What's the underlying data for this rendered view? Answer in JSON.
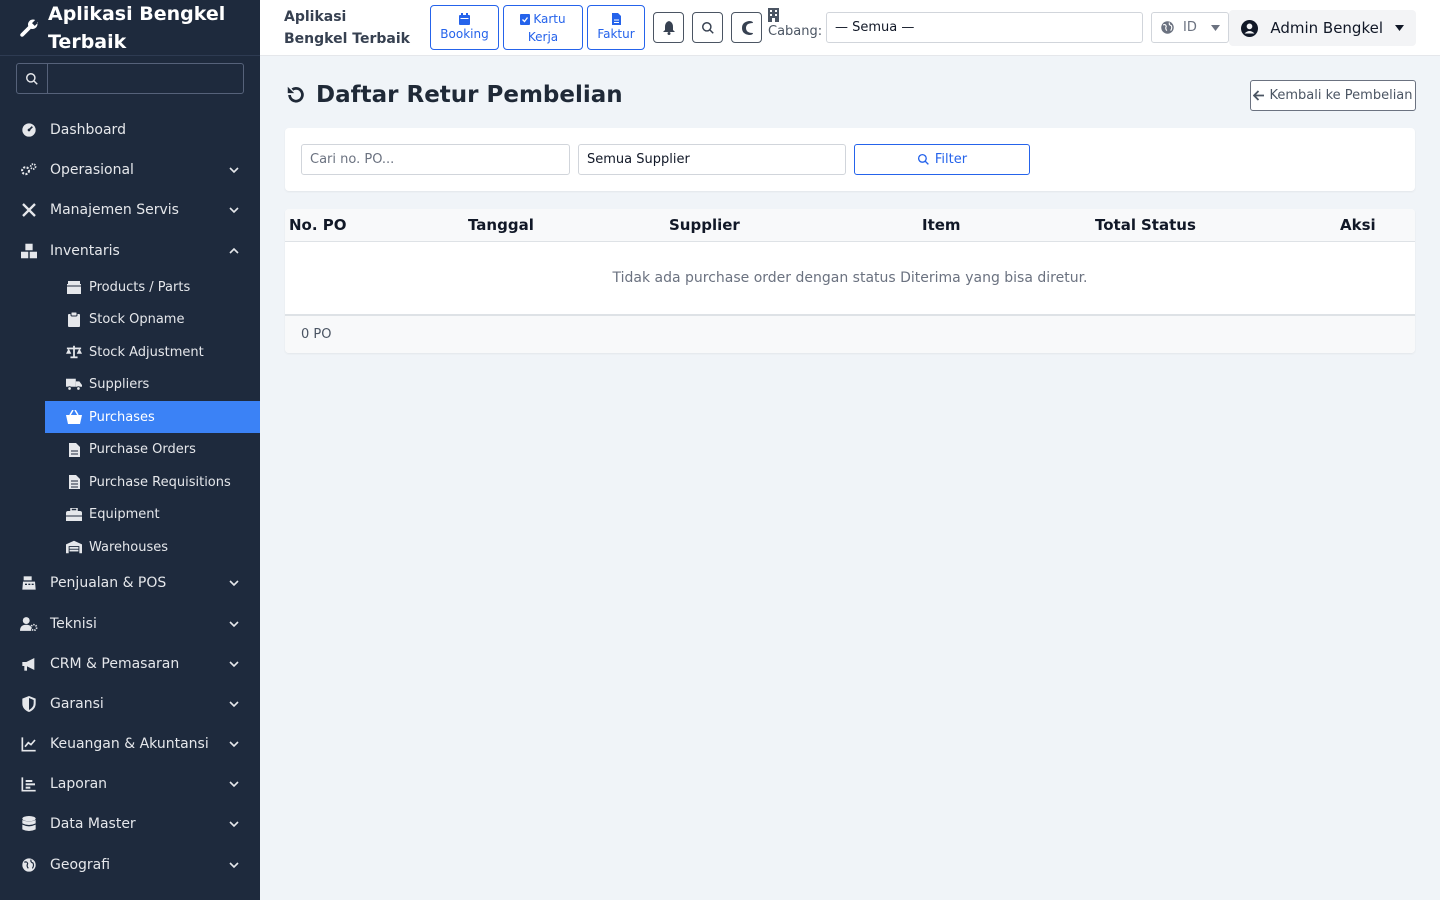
{
  "sidebar": {
    "brand": "Aplikasi Bengkel Terbaik",
    "search_placeholder": "",
    "items": [
      {
        "label": "Dashboard",
        "icon": "dashboard-gauge-icon"
      },
      {
        "label": "Operasional",
        "icon": "gears-icon"
      },
      {
        "label": "Manajemen Servis",
        "icon": "tools-icon"
      },
      {
        "label": "Inventaris",
        "icon": "boxes-icon"
      },
      {
        "label": "Penjualan & POS",
        "icon": "cash-register-icon"
      },
      {
        "label": "Teknisi",
        "icon": "user-gear-icon"
      },
      {
        "label": "CRM & Pemasaran",
        "icon": "bullhorn-icon"
      },
      {
        "label": "Garansi",
        "icon": "shield-icon"
      },
      {
        "label": "Keuangan & Akuntansi",
        "icon": "chart-line-icon"
      },
      {
        "label": "Laporan",
        "icon": "chart-bars-icon"
      },
      {
        "label": "Data Master",
        "icon": "database-icon"
      },
      {
        "label": "Geografi",
        "icon": "globe-icon"
      }
    ],
    "inventaris_sub": [
      {
        "label": "Products / Parts",
        "icon": "box-icon"
      },
      {
        "label": "Stock Opname",
        "icon": "clipboard-icon"
      },
      {
        "label": "Stock Adjustment",
        "icon": "scale-icon"
      },
      {
        "label": "Suppliers",
        "icon": "truck-icon"
      },
      {
        "label": "Purchases",
        "icon": "basket-icon",
        "active": true
      },
      {
        "label": "Purchase Orders",
        "icon": "file-invoice-icon"
      },
      {
        "label": "Purchase Requisitions",
        "icon": "file-list-icon"
      },
      {
        "label": "Equipment",
        "icon": "toolbox-icon"
      },
      {
        "label": "Warehouses",
        "icon": "warehouse-icon"
      }
    ]
  },
  "topbar": {
    "app_name": "Aplikasi Bengkel Terbaik",
    "quick": {
      "booking": "Booking",
      "kartu_kerja_1": "Kartu",
      "kartu_kerja_2": "Kerja",
      "faktur": "Faktur"
    },
    "cabang_label": "Cabang:",
    "cabang_value": "— Semua —",
    "lang": "ID",
    "user": "Admin Bengkel"
  },
  "page": {
    "title": "Daftar Retur Pembelian",
    "back_label": "Kembali ke Pembelian",
    "filter": {
      "search_placeholder": "Cari no. PO...",
      "supplier_value": "Semua Supplier",
      "button": "Filter"
    },
    "table": {
      "headers": [
        "No. PO",
        "Tanggal",
        "Supplier",
        "Item",
        "Total",
        "Status",
        "Aksi"
      ],
      "empty_message": "Tidak ada purchase order dengan status Diterima yang bisa diretur.",
      "footer": "0 PO"
    }
  },
  "colors": {
    "sidebar_bg": "#1e2a3d",
    "accent": "#3b82f6",
    "primary_outline": "#2563eb",
    "page_bg": "#f0f4f8"
  }
}
